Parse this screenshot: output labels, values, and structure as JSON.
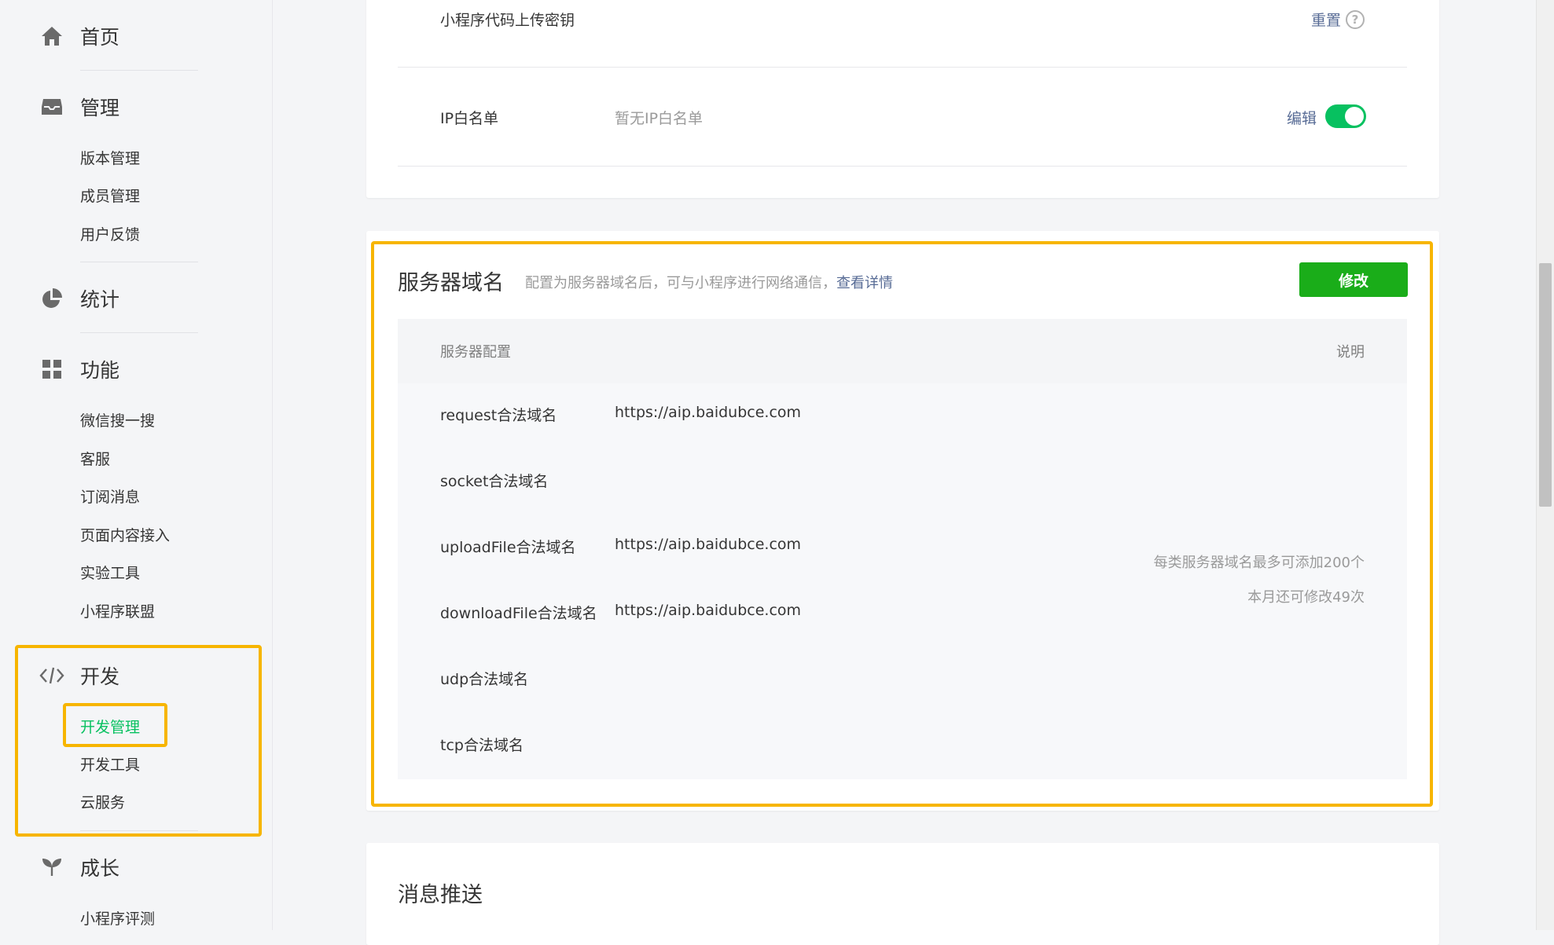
{
  "sidebar": {
    "home": "首页",
    "manage": {
      "label": "管理",
      "items": [
        "版本管理",
        "成员管理",
        "用户反馈"
      ]
    },
    "stats": "统计",
    "features": {
      "label": "功能",
      "items": [
        "微信搜一搜",
        "客服",
        "订阅消息",
        "页面内容接入",
        "实验工具",
        "小程序联盟"
      ]
    },
    "develop": {
      "label": "开发",
      "items": [
        "开发管理",
        "开发工具",
        "云服务"
      ]
    },
    "growth": {
      "label": "成长",
      "items": [
        "小程序评测"
      ]
    }
  },
  "dev_settings": {
    "upload_key_label": "小程序代码上传密钥",
    "reset_link": "重置",
    "help_glyph": "?",
    "ip_whitelist_label": "IP白名单",
    "ip_whitelist_value": "暂无IP白名单",
    "edit_link": "编辑"
  },
  "server_domain": {
    "title": "服务器域名",
    "desc": "配置为服务器域名后，可与小程序进行网络通信，",
    "details_link": "查看详情",
    "modify_button": "修改",
    "col_config": "服务器配置",
    "col_desc": "说明",
    "rows": [
      {
        "label": "request合法域名",
        "value": "https://aip.baidubce.com"
      },
      {
        "label": "socket合法域名",
        "value": ""
      },
      {
        "label": "uploadFile合法域名",
        "value": "https://aip.baidubce.com"
      },
      {
        "label": "downloadFile合法域名",
        "value": "https://aip.baidubce.com"
      },
      {
        "label": "udp合法域名",
        "value": ""
      },
      {
        "label": "tcp合法域名",
        "value": ""
      }
    ],
    "note_line1": "每类服务器域名最多可添加200个",
    "note_line2": "本月还可修改49次"
  },
  "message_push": {
    "title": "消息推送"
  },
  "colors": {
    "accent_green": "#07c160",
    "button_green": "#1aad19",
    "link_blue": "#576b95",
    "highlight_yellow": "#f7b500"
  }
}
